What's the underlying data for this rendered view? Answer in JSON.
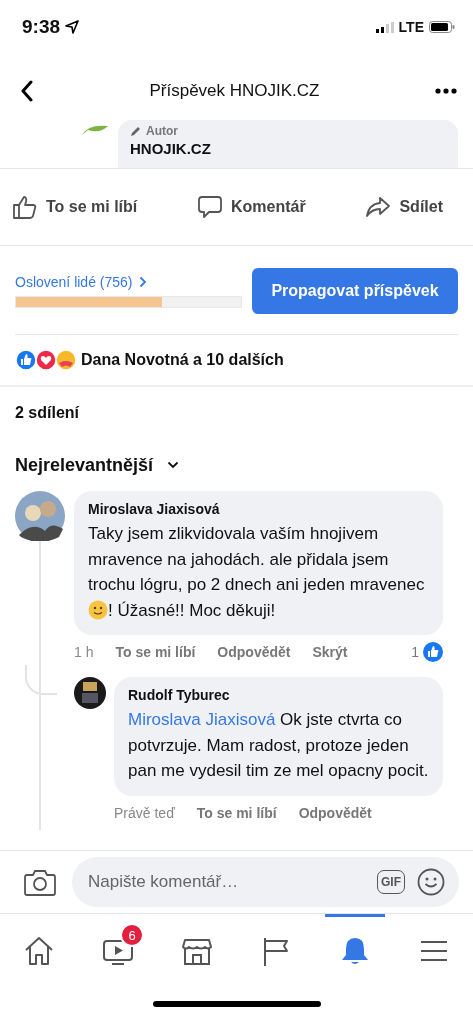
{
  "status_bar": {
    "time": "9:38",
    "network": "LTE"
  },
  "header": {
    "title": "Příspěvek HNOJIK.CZ"
  },
  "post_preview": {
    "badge": "Autor",
    "author": "HNOJIK.CZ"
  },
  "actions": [
    {
      "kind": "like",
      "label": "To se mi líbí"
    },
    {
      "kind": "comment",
      "label": "Komentář"
    },
    {
      "kind": "share",
      "label": "Sdílet"
    }
  ],
  "reach": {
    "label": "Oslovení lidé (756)",
    "level": 0.65,
    "button": "Propagovat příspěvek"
  },
  "reactions": {
    "text": "Dana Novotná a 10 dalších"
  },
  "shares": "2 sdílení",
  "sort": {
    "label": "Nejrelevantnější"
  },
  "comments": [
    {
      "author": "Miroslava Jiaxisová",
      "parts": [
        {
          "kind": "text",
          "text": "Taky jsem zlikvidovala vaším hnojivem mravence na jahodách. ale přidala jsem trochu lógru, po 2 dnech ani jeden mravenec"
        },
        {
          "kind": "emoji"
        },
        {
          "kind": "text",
          "text": "! Úžasné!! Moc děkuji!"
        }
      ],
      "time": "1 h",
      "actions": [
        "To se mi líbí",
        "Odpovědět",
        "Skrýt"
      ],
      "likes": "1",
      "replies": [
        {
          "author": "Rudolf Tyburec",
          "mention": "Miroslava Jiaxisová",
          "text": "Ok jste ctvrta co potvrzuje. Mam radost, protoze jeden pan me vydesil tim ze mel opacny pocit.",
          "time": "Právě teď",
          "actions": [
            "To se mi líbí",
            "Odpovědět"
          ]
        }
      ]
    }
  ],
  "composer": {
    "placeholder": "Napište komentář…",
    "gif": "GIF"
  },
  "tab_bar": [
    {
      "kind": "home",
      "selected": false
    },
    {
      "kind": "video",
      "selected": false,
      "badge": "6"
    },
    {
      "kind": "marketplace",
      "selected": false
    },
    {
      "kind": "pages",
      "selected": false
    },
    {
      "kind": "notifications",
      "selected": true
    },
    {
      "kind": "menu",
      "selected": false
    }
  ]
}
